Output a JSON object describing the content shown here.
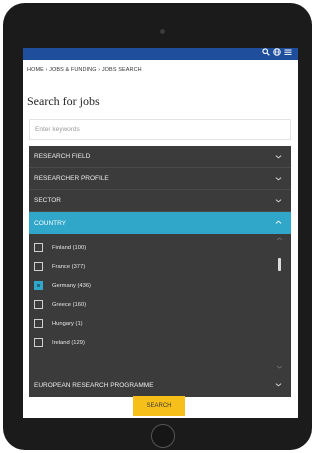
{
  "header": {
    "icons": [
      "search-icon",
      "globe-icon",
      "menu-icon"
    ]
  },
  "breadcrumb": "HOME › JOBS & FUNDING › JOBS SEARCH",
  "page_title": "Search for jobs",
  "search": {
    "placeholder": "Enter keywords",
    "value": ""
  },
  "filters": {
    "research_field": "RESEARCH FIELD",
    "researcher_profile": "RESEARCHER PROFILE",
    "sector": "SECTOR",
    "country": "COUNTRY",
    "european_programme": "EUROPEAN RESEARCH PROGRAMME"
  },
  "countries": [
    {
      "label": "Finland (100)",
      "checked": false
    },
    {
      "label": "France (377)",
      "checked": false
    },
    {
      "label": "Germany (436)",
      "checked": true
    },
    {
      "label": "Greece (160)",
      "checked": false
    },
    {
      "label": "Hungary (1)",
      "checked": false
    },
    {
      "label": "Ireland (129)",
      "checked": false
    }
  ],
  "search_button": "SEARCH",
  "colors": {
    "header": "#1f4e9c",
    "accent": "#30a6c9",
    "button": "#f6bf1a",
    "panel": "#3b3b3b"
  }
}
